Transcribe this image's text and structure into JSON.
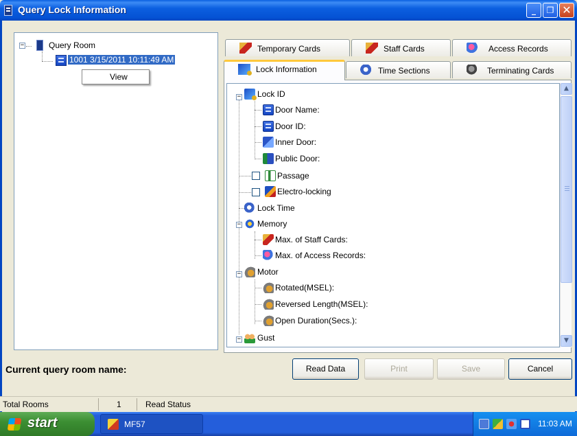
{
  "window": {
    "title": "Query Lock Information"
  },
  "left_tree": {
    "root_label": "Query Room",
    "selected_item": "1001 3/15/2011 10:11:49 AM",
    "context_menu": {
      "items": [
        "View"
      ]
    }
  },
  "tabs": {
    "row_back": [
      "Temporary Cards",
      "Staff Cards",
      "Access Records"
    ],
    "row_front": [
      "Lock Information",
      "Time Sections",
      "Terminating Cards"
    ],
    "active": "Lock Information"
  },
  "lock_tree": {
    "lock_id": "Lock ID",
    "door_name": "Door Name:",
    "door_id": "Door ID:",
    "inner_door": "Inner Door:",
    "public_door": "Public Door:",
    "passage": "Passage",
    "electro_locking": "Electro-locking",
    "lock_time": "Lock Time",
    "memory": "Memory",
    "max_staff_cards": "Max. of Staff Cards:",
    "max_access_records": "Max. of Access Records:",
    "motor": "Motor",
    "rotated": "Rotated(MSEL):",
    "reversed_length": "Reversed Length(MSEL):",
    "open_duration": "Open Duration(Secs.):",
    "gust": "Gust"
  },
  "bottom": {
    "room_name_label": "Current query room name:",
    "buttons": {
      "read_data": "Read Data",
      "print": "Print",
      "save": "Save",
      "cancel": "Cancel"
    }
  },
  "statusbar": {
    "total_rooms_label": "Total Rooms",
    "total_rooms_value": "1",
    "read_status_label": "Read Status"
  },
  "taskbar": {
    "start_label": "start",
    "task_label": "MF57",
    "clock": "11:03 AM"
  }
}
